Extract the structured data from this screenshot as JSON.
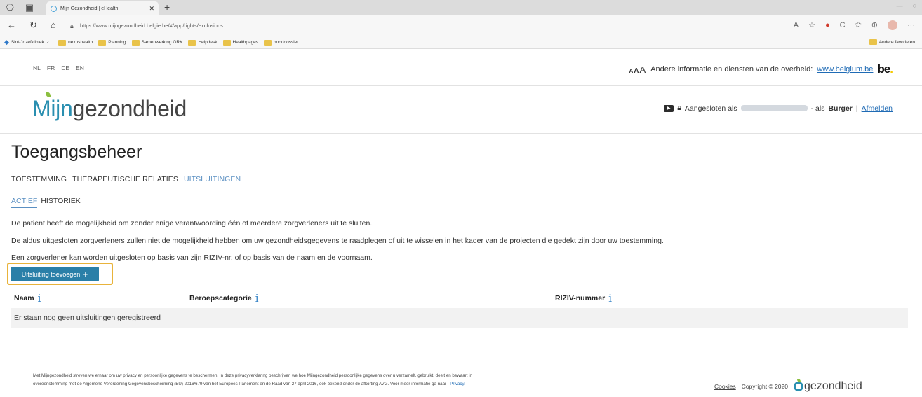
{
  "browser": {
    "tab_title": "Mijn Gezondheid | eHealth",
    "url": "https://www.mijngezondheid.belgie.be/#/app/rights/exclusions",
    "favorites": [
      {
        "label": "Sint-Jozefkliniek Iz...",
        "icon": "pin-icon"
      },
      {
        "label": "nexushealth",
        "icon": "folder-icon"
      },
      {
        "label": "Planning",
        "icon": "folder-icon"
      },
      {
        "label": "Samenwerking GRK",
        "icon": "folder-icon"
      },
      {
        "label": "Helpdesk",
        "icon": "folder-icon"
      },
      {
        "label": "Healthpages",
        "icon": "folder-icon"
      },
      {
        "label": "nooddossier",
        "icon": "folder-icon"
      }
    ],
    "other_favorites": "Andere favorieten"
  },
  "header": {
    "languages": [
      "NL",
      "FR",
      "DE",
      "EN"
    ],
    "active_language": "NL",
    "font_size_labels": [
      "A",
      "A",
      "A"
    ],
    "other_info_text": "Andere informatie en diensten van de overheid:",
    "other_info_link": "www.belgium.be",
    "be_logo": "be",
    "logo_prefix": "Mijn",
    "logo_suffix": "gezondheid",
    "logged_in_prefix": "Aangesloten als",
    "logged_in_role_prefix": "- als",
    "logged_in_role": "Burger",
    "separator": "|",
    "logout": "Afmelden"
  },
  "main": {
    "title": "Toegangsbeheer",
    "tabs": [
      {
        "label": "TOESTEMMING",
        "active": false
      },
      {
        "label": "THERAPEUTISCHE RELATIES",
        "active": false
      },
      {
        "label": "UITSLUITINGEN",
        "active": true
      }
    ],
    "subtabs": [
      {
        "label": "ACTIEF",
        "active": true
      },
      {
        "label": "HISTORIEK",
        "active": false
      }
    ],
    "paragraphs": [
      "De patiënt heeft de mogelijkheid om zonder enige verantwoording één of meerdere zorgverleners uit te sluiten.",
      "De aldus uitgesloten zorgverleners zullen niet de mogelijkheid hebben om uw gezondheidsgegevens te raadplegen of uit te wisselen in het kader van de projecten die gedekt zijn door uw toestemming.",
      "Een zorgverlener kan worden uitgesloten op basis van zijn RIZIV-nr. of op basis van de naam en de voornaam."
    ],
    "add_button": "Uitsluiting toevoegen",
    "add_button_icon": "+",
    "table": {
      "columns": [
        "Naam",
        "Beroepscategorie",
        "RIZIV-nummer"
      ],
      "info_glyph": "i",
      "empty_message": "Er staan nog geen uitsluitingen geregistreerd"
    }
  },
  "footer": {
    "privacy_text_1": "Met Mijngezondheid streven we ernaar om uw privacy en persoonlijke gegevens te beschermen. In deze privacyverklaring beschrijven we hoe Mijngezondheid persoonlijke gegevens over u verzamelt, gebruikt, deelt en bewaart in",
    "privacy_text_2": "overeenstemming met de Algemene Verordening Gegevensbescherming (EU) 2016/679 van het Europees Parlement en de Raad van 27 april 2016, ook bekend onder de afkorting AVG. Voor meer informatie ga naar :",
    "privacy_link": "Privacy.",
    "cookies": "Cookies",
    "copyright": "Copyright © 2020",
    "footer_logo": "gezondheid"
  }
}
